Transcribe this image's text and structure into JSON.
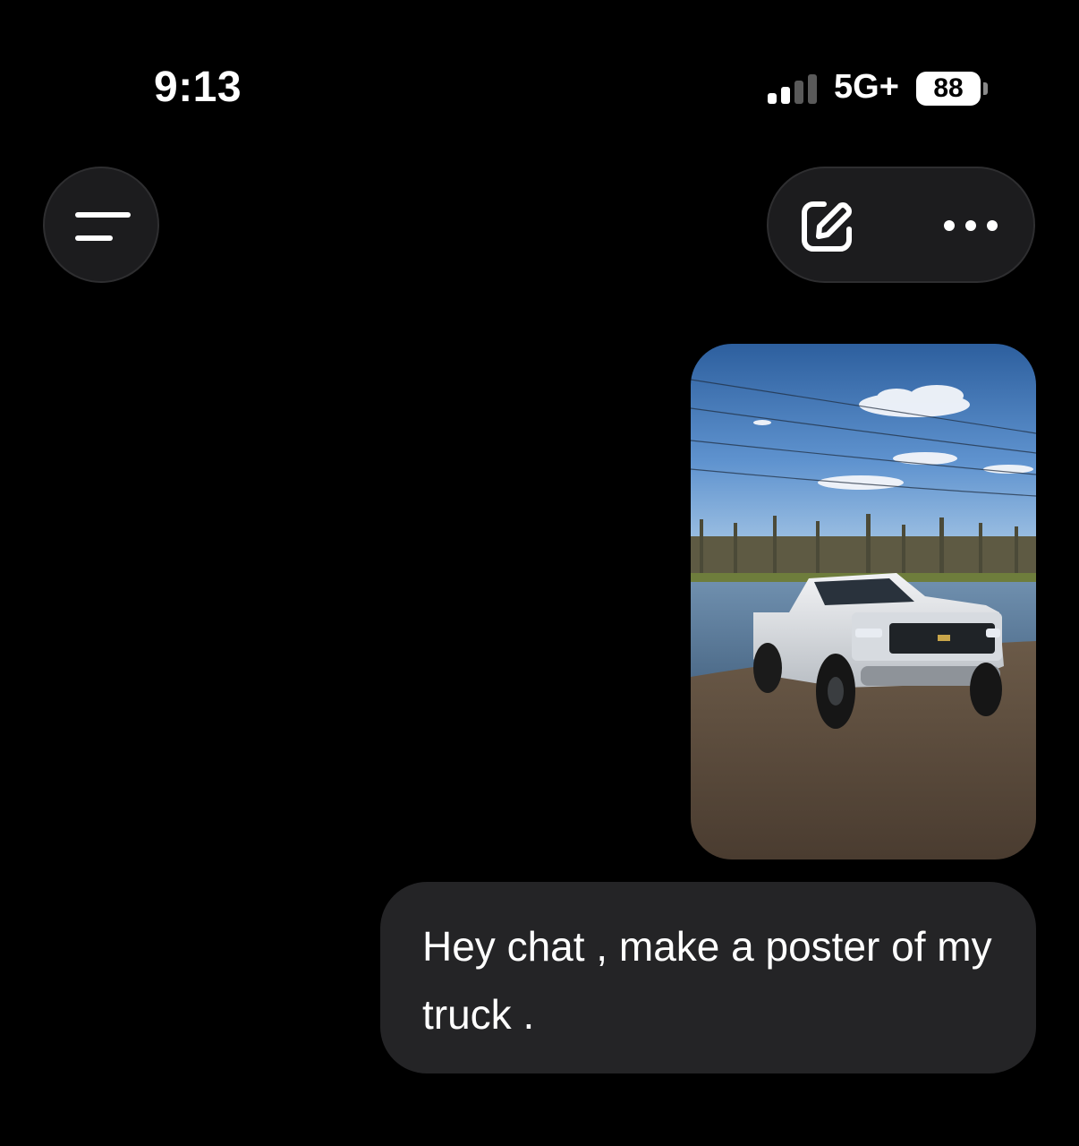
{
  "status_bar": {
    "time": "9:13",
    "network": "5G+",
    "battery": "88",
    "signal_bars_active": 2,
    "signal_bars_total": 4
  },
  "header": {
    "menu_icon": "menu-icon",
    "new_chat_icon": "edit-icon",
    "more_icon": "more-icon"
  },
  "conversation": {
    "image_subject": "truck-photo",
    "message": "Hey chat , make a poster of my truck ."
  },
  "colors": {
    "background": "#000000",
    "button_bg": "#1c1c1e",
    "bubble_bg": "#242426",
    "text": "#ffffff",
    "signal_inactive": "#5a5a5a"
  }
}
